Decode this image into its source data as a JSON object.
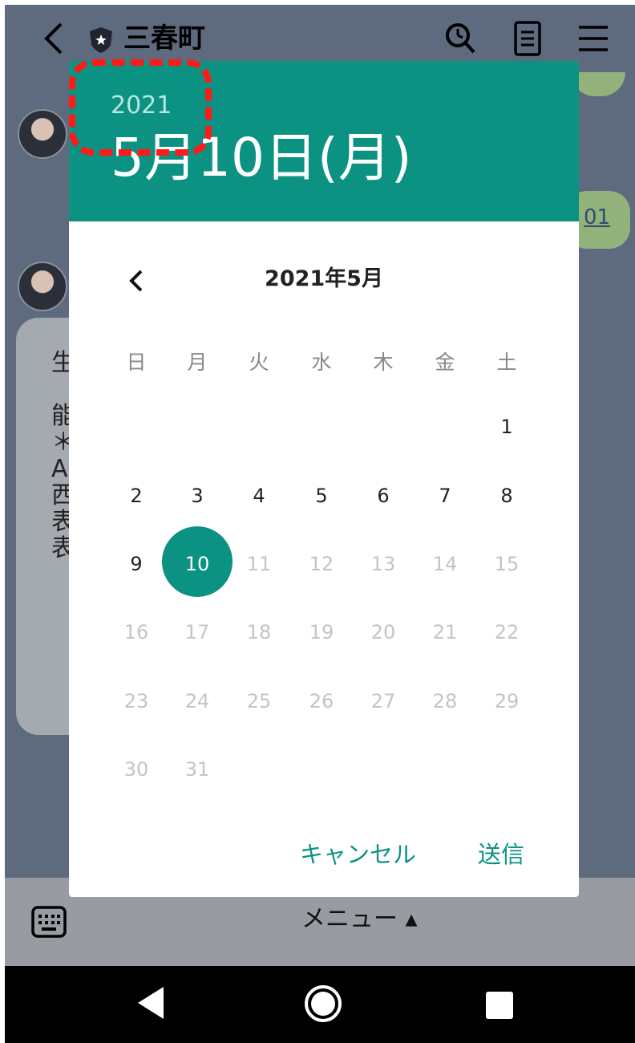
{
  "app_bar": {
    "title": "三春町",
    "icons": [
      "back-icon",
      "shield-icon",
      "search-icon",
      "notes-icon",
      "menu-icon"
    ]
  },
  "background_chat": {
    "left_bubble_text": "生\n\n能\n＊\nA\n西\n表\n表",
    "right_bubble_link": "01"
  },
  "date_picker": {
    "header": {
      "year": "2021",
      "date": "5月10日(月)"
    },
    "month_label": "2021年5月",
    "weekdays": [
      "日",
      "月",
      "火",
      "水",
      "木",
      "金",
      "土"
    ],
    "weeks": [
      [
        null,
        null,
        null,
        null,
        null,
        null,
        "1"
      ],
      [
        "2",
        "3",
        "4",
        "5",
        "6",
        "7",
        "8"
      ],
      [
        "9",
        "10",
        "11",
        "12",
        "13",
        "14",
        "15"
      ],
      [
        "16",
        "17",
        "18",
        "19",
        "20",
        "21",
        "22"
      ],
      [
        "23",
        "24",
        "25",
        "26",
        "27",
        "28",
        "29"
      ],
      [
        "30",
        "31",
        null,
        null,
        null,
        null,
        null
      ]
    ],
    "selected_day": "10",
    "last_enabled_day": 10,
    "accent_color": "#0b9283",
    "buttons": {
      "cancel": "キャンセル",
      "send": "送信"
    }
  },
  "bottom_bar": {
    "menu_label": "メニュー ▴"
  },
  "system_nav": [
    "nav-back-icon",
    "nav-home-icon",
    "nav-recent-icon"
  ]
}
